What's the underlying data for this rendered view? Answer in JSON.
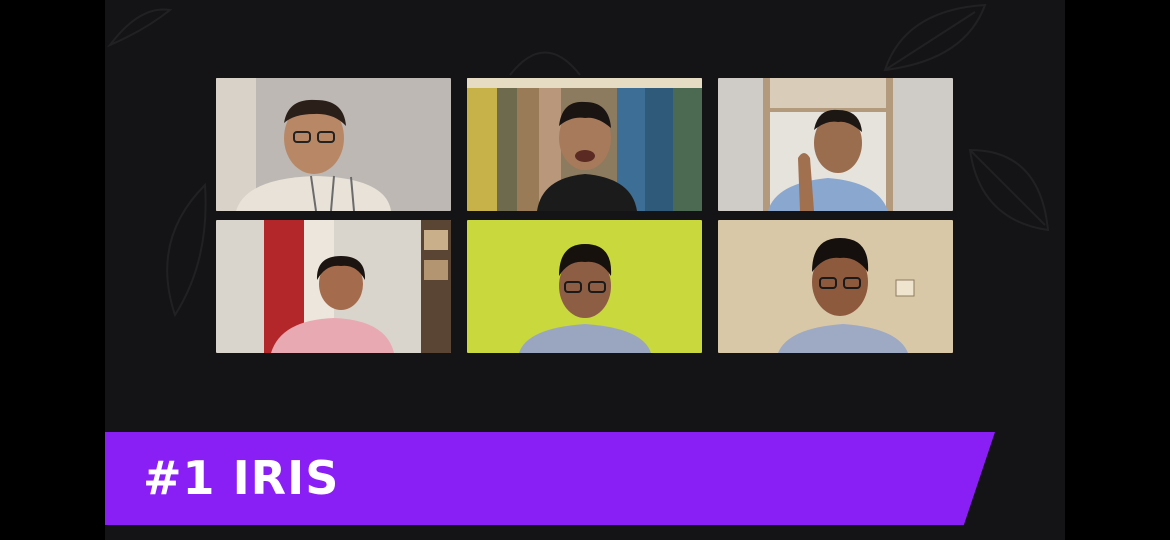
{
  "app": {
    "accent_color": "#8a1ff5",
    "background_color": "#141315"
  },
  "participants": [
    {
      "id": "p1",
      "tile_bg": "#bdb8b3",
      "shirt": "#e8e2d8"
    },
    {
      "id": "p2",
      "tile_bg": "#8d7b5f",
      "shirt": "#1b1b1b"
    },
    {
      "id": "p3",
      "tile_bg": "#cfccc8",
      "shirt": "#8aa7cf"
    },
    {
      "id": "p4",
      "tile_bg": "#d9d4cc",
      "shirt": "#e8a9b2"
    },
    {
      "id": "p5",
      "tile_bg": "#c9d83c",
      "shirt": "#9aa6c0"
    },
    {
      "id": "p6",
      "tile_bg": "#d8c8a8",
      "shirt": "#9ea9c4"
    }
  ],
  "banner": {
    "text": "#1 IRIS"
  }
}
